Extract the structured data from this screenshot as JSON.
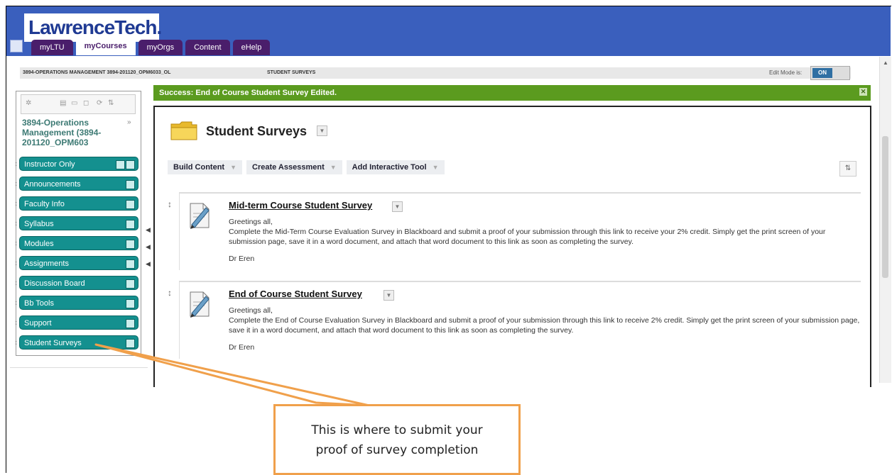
{
  "header": {
    "logo": "LawrenceTech.",
    "tabs": [
      {
        "label": "myLTU"
      },
      {
        "label": "myCourses",
        "active": true
      },
      {
        "label": "myOrgs"
      },
      {
        "label": "Content"
      },
      {
        "label": "eHelp"
      }
    ]
  },
  "breadcrumb": {
    "course": "3894-OPERATIONS MANAGEMENT 3894-201120_OPM6033_OL",
    "page": "STUDENT SURVEYS"
  },
  "edit_mode": {
    "label": "Edit Mode is:",
    "value": "ON"
  },
  "sidebar": {
    "course_title": "3894-Operations Management (3894-201120_OPM603",
    "items": [
      {
        "label": "Instructor Only"
      },
      {
        "label": "Announcements"
      },
      {
        "label": "Faculty Info"
      },
      {
        "label": "Syllabus"
      },
      {
        "label": "Modules"
      },
      {
        "label": "Assignments"
      },
      {
        "label": "Discussion Board"
      },
      {
        "label": "Bb Tools"
      },
      {
        "label": "Support"
      },
      {
        "label": "Student Surveys"
      }
    ]
  },
  "success_message": "Success: End of Course Student Survey Edited.",
  "content": {
    "title": "Student Surveys",
    "actions": [
      {
        "label": "Build Content"
      },
      {
        "label": "Create Assessment"
      },
      {
        "label": "Add Interactive Tool"
      }
    ],
    "items": [
      {
        "title": "Mid-term Course Student Survey",
        "greeting": "Greetings all,",
        "body": "Complete the Mid-Term Course Evaluation Survey in Blackboard and submit a proof of your submission through this link to receive your 2% credit. Simply get the print screen of your submission page, save it in a word document, and attach that word document to this link as soon as completing the survey.",
        "signature": "Dr Eren"
      },
      {
        "title": "End of Course Student Survey",
        "greeting": "Greetings all,",
        "body": "Complete the End of Course Evaluation Survey in Blackboard and submit a proof of your submission through this link to receive 2% credit. Simply get the print screen of your submission page, save it in a word document, and attach that word document to this link as soon as completing the survey.",
        "signature": "Dr Eren"
      }
    ]
  },
  "callout": {
    "line1": "This is where to submit your",
    "line2": "proof of survey completion"
  },
  "colors": {
    "header_blue": "#3a5fbd",
    "tab_purple": "#4a1e6b",
    "menu_teal": "#14908f",
    "success_green": "#5b9b1f",
    "callout_orange": "#f0a04b"
  }
}
